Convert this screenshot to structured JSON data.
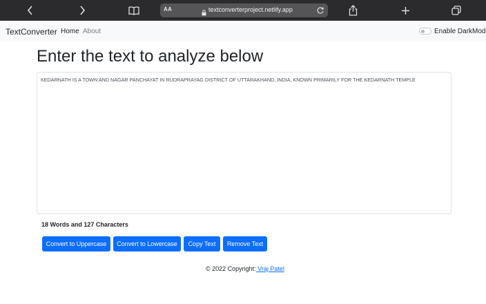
{
  "browser": {
    "text_size_label": "AA",
    "url": "textconverterproject.netlify.app"
  },
  "navbar": {
    "brand": "TextConverter",
    "home": "Home",
    "about": "About",
    "darkmode_label": "Enable DarkMode"
  },
  "main": {
    "heading": "Enter the text to analyze below",
    "text_value": "KEDARNATH IS A TOWN AND NAGAR PANCHAYAT IN RUDRAPRAYAG DISTRICT OF UTTARAKHAND, INDIA, KNOWN PRIMARILY FOR THE KEDARNATH TEMPLE",
    "summary": "18 Words and 127 Characters",
    "buttons": {
      "uppercase": "Convert to Uppercase",
      "lowercase": "Convert to Lowercase",
      "copy": "Copy Text",
      "remove": "Remove Text"
    }
  },
  "footer": {
    "text": "© 2022 Copyright:",
    "author": " Vraj Patel"
  },
  "colors": {
    "primary": "#0d6efd",
    "navbar_bg": "#f8f9fa",
    "browser_bg": "#2b2b2d"
  }
}
